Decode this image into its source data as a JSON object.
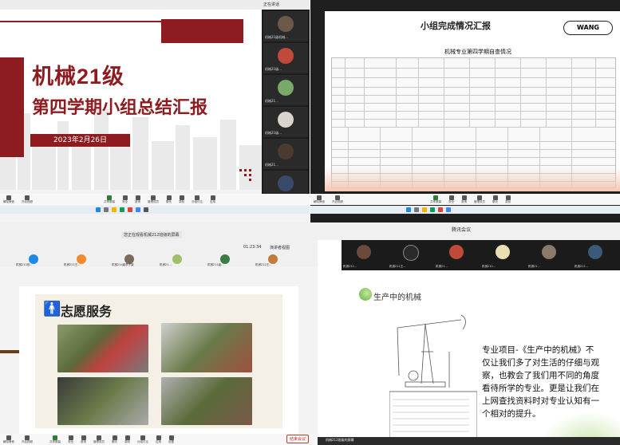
{
  "q1": {
    "title": "机械21级",
    "subtitle": "第四学期小组总结汇报",
    "date": "2023年2月26日",
    "participants": [
      {
        "name": "机械21级机械..."
      },
      {
        "name": "机械21级..."
      },
      {
        "name": "机械21..."
      },
      {
        "name": "机械21级..."
      },
      {
        "name": "机械21..."
      },
      {
        "name": "机械21..."
      }
    ],
    "toolbar": [
      "解除静音",
      "开启视频",
      "共享屏幕",
      "安全",
      "邀请",
      "管理成员",
      "聊天",
      "录制",
      "分组讨论",
      "应用",
      "设置"
    ]
  },
  "q2": {
    "title": "小组完成情况汇报",
    "button": "WANG",
    "table_title": "机械专业第四学期自查情况",
    "toolbar": [
      "解除静音",
      "开启视频",
      "共享屏幕",
      "安全",
      "邀请",
      "管理成员",
      "聊天",
      "录制",
      "应用",
      "设置"
    ]
  },
  "q3": {
    "notice": "您正在观看机械212班级的屏幕",
    "timer": "01:23:34",
    "view": "演讲者视图",
    "heading": "志愿服务",
    "participants": [
      {
        "name": "机械212班..."
      },
      {
        "name": "机械211王..."
      },
      {
        "name": "机械214级李子豪"
      },
      {
        "name": "机械21..."
      },
      {
        "name": "机械211级..."
      },
      {
        "name": "机械212王..."
      }
    ],
    "toolbar": [
      "解除静音",
      "开启视频",
      "共享屏幕",
      "安全",
      "邀请",
      "管理成员",
      "聊天",
      "录制",
      "分组讨论",
      "应用",
      "设置"
    ],
    "end_button": "结束会议"
  },
  "q4": {
    "title": "腾讯会议",
    "heading": "生产中的机械",
    "text": "专业项目-《生产中的机械》不仅让我们多了对生活的仔细与观察，也教会了我们用不同的角度看待所学的专业。更是让我们在上网查找资料时对专业认知有一个相对的提升。",
    "bottom_label": "机械212班级的屏幕",
    "participants": [
      {
        "name": "机械212..."
      },
      {
        "name": "机械211王..."
      },
      {
        "name": "机械21..."
      },
      {
        "name": "机械212..."
      },
      {
        "name": "机械21..."
      },
      {
        "name": "机械211..."
      }
    ]
  },
  "colors": {
    "brand_red": "#8e1b1f",
    "slide_bg": "#ffffff",
    "end_red": "#c13a2c"
  }
}
